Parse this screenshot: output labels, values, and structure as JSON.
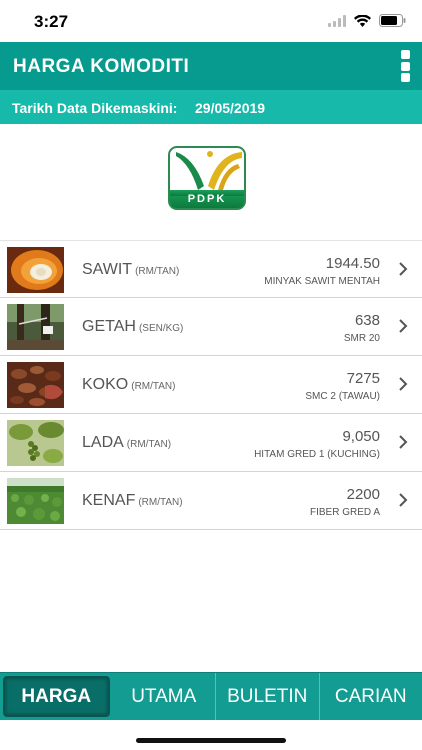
{
  "status": {
    "time": "3:27"
  },
  "header": {
    "title": "HARGA KOMODITI"
  },
  "update": {
    "label": "Tarikh Data Dikemaskini:",
    "date": "29/05/2019"
  },
  "logo": {
    "text": "PDPK"
  },
  "commodities": [
    {
      "name": "SAWIT",
      "unit": "(RM/TAN)",
      "price": "1944.50",
      "grade": "MINYAK SAWIT MENTAH"
    },
    {
      "name": "GETAH",
      "unit": "(SEN/KG)",
      "price": "638",
      "grade": "SMR 20"
    },
    {
      "name": "KOKO",
      "unit": "(RM/TAN)",
      "price": "7275",
      "grade": "SMC 2 (TAWAU)"
    },
    {
      "name": "LADA",
      "unit": "(RM/TAN)",
      "price": "9,050",
      "grade": "HITAM GRED 1 (KUCHING)"
    },
    {
      "name": "KENAF",
      "unit": "(RM/TAN)",
      "price": "2200",
      "grade": "FIBER GRED A"
    }
  ],
  "tabs": [
    {
      "label": "HARGA",
      "active": true
    },
    {
      "label": "UTAMA",
      "active": false
    },
    {
      "label": "BULETIN",
      "active": false
    },
    {
      "label": "CARIAN",
      "active": false
    }
  ],
  "colors": {
    "header": "#079a8e",
    "subheader": "#17b9aa",
    "tabbar": "#129c92",
    "tab_active": "#0a6e68"
  }
}
